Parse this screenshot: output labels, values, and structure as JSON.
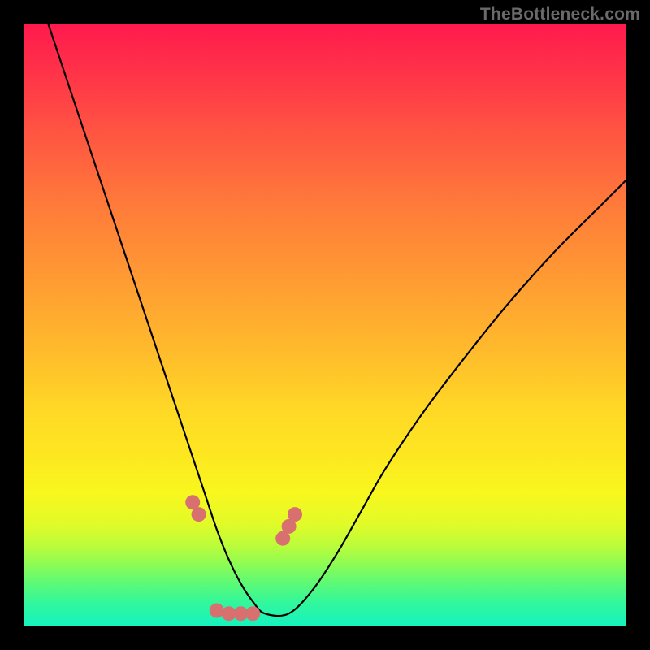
{
  "watermark": "TheBottleneck.com",
  "chart_data": {
    "type": "line",
    "title": "",
    "xlabel": "",
    "ylabel": "",
    "xlim": [
      0,
      100
    ],
    "ylim": [
      0,
      100
    ],
    "grid": false,
    "legend": false,
    "series": [
      {
        "name": "curve",
        "x": [
          4,
          8,
          12,
          16,
          20,
          24,
          28,
          30,
          32,
          34,
          36,
          38,
          40,
          44,
          48,
          52,
          56,
          60,
          66,
          72,
          80,
          88,
          96,
          100
        ],
        "y": [
          100,
          88,
          76,
          64,
          52,
          40,
          28,
          22,
          16,
          11,
          7,
          4,
          2,
          2,
          6,
          12,
          19,
          26,
          35,
          43,
          53,
          62,
          70,
          74
        ]
      }
    ],
    "markers": {
      "name": "highlighted-points",
      "x": [
        28,
        29,
        32,
        34,
        36,
        38,
        43,
        44,
        45
      ],
      "y": [
        20.5,
        18.5,
        2.5,
        2,
        2,
        2,
        14.5,
        16.5,
        18.5
      ]
    },
    "gradient_stops": [
      {
        "pos": 0.0,
        "color": "#ff1a4d"
      },
      {
        "pos": 0.5,
        "color": "#ffc028"
      },
      {
        "pos": 0.8,
        "color": "#f8f71e"
      },
      {
        "pos": 1.0,
        "color": "#15f3bf"
      }
    ]
  }
}
